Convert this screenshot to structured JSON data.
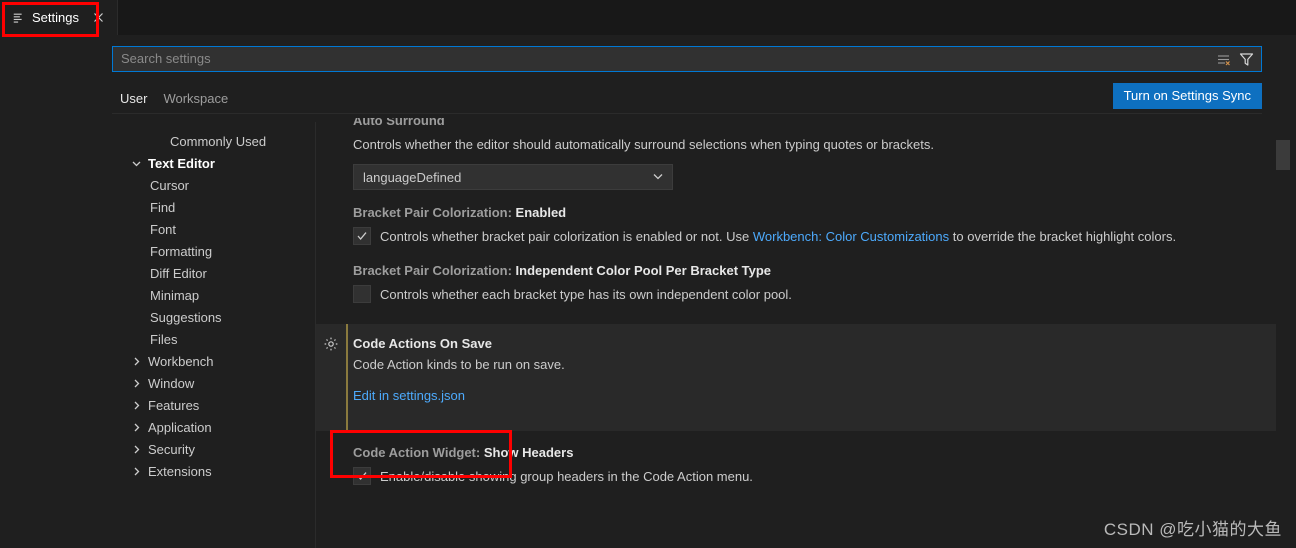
{
  "window": {
    "tab": {
      "label": "Settings",
      "icon": "settings-list-icon",
      "close_icon": "close-icon"
    }
  },
  "search": {
    "placeholder": "Search settings",
    "value": "",
    "clear_filters_icon": "clear-filters-icon",
    "filter_icon": "filter-funnel-icon"
  },
  "scope": {
    "tabs": [
      {
        "label": "User",
        "active": true
      },
      {
        "label": "Workspace",
        "active": false
      }
    ],
    "sync_button": "Turn on Settings Sync"
  },
  "toc": {
    "items": [
      {
        "label": "Commonly Used",
        "level": 0,
        "chevron": "none",
        "selected": false
      },
      {
        "label": "Text Editor",
        "level": 0,
        "chevron": "down",
        "selected": true
      },
      {
        "label": "Cursor",
        "level": 1,
        "chevron": "none",
        "selected": false
      },
      {
        "label": "Find",
        "level": 1,
        "chevron": "none",
        "selected": false
      },
      {
        "label": "Font",
        "level": 1,
        "chevron": "none",
        "selected": false
      },
      {
        "label": "Formatting",
        "level": 1,
        "chevron": "none",
        "selected": false
      },
      {
        "label": "Diff Editor",
        "level": 1,
        "chevron": "none",
        "selected": false
      },
      {
        "label": "Minimap",
        "level": 1,
        "chevron": "none",
        "selected": false
      },
      {
        "label": "Suggestions",
        "level": 1,
        "chevron": "none",
        "selected": false
      },
      {
        "label": "Files",
        "level": 1,
        "chevron": "none",
        "selected": false
      },
      {
        "label": "Workbench",
        "level": 0,
        "chevron": "right",
        "selected": false
      },
      {
        "label": "Window",
        "level": 0,
        "chevron": "right",
        "selected": false
      },
      {
        "label": "Features",
        "level": 0,
        "chevron": "right",
        "selected": false
      },
      {
        "label": "Application",
        "level": 0,
        "chevron": "right",
        "selected": false
      },
      {
        "label": "Security",
        "level": 0,
        "chevron": "right",
        "selected": false
      },
      {
        "label": "Extensions",
        "level": 0,
        "chevron": "right",
        "selected": false
      }
    ]
  },
  "settings": {
    "auto_surround": {
      "title_prefix": "",
      "title_value": "Auto Surround",
      "description": "Controls whether the editor should automatically surround selections when typing quotes or brackets.",
      "select_value": "languageDefined",
      "chevron_icon": "chevron-down-icon"
    },
    "bracket_enabled": {
      "title_prefix": "Bracket Pair Colorization: ",
      "title_value": "Enabled",
      "checked": true,
      "desc_before": "Controls whether bracket pair colorization is enabled or not. Use ",
      "desc_link": "Workbench: Color Customizations",
      "desc_after": " to override the bracket highlight colors."
    },
    "bracket_independent": {
      "title_prefix": "Bracket Pair Colorization: ",
      "title_value": "Independent Color Pool Per Bracket Type",
      "checked": false,
      "description": "Controls whether each bracket type has its own independent color pool."
    },
    "code_actions_on_save": {
      "title_prefix": "",
      "title_value": "Code Actions On Save",
      "description": "Code Action kinds to be run on save.",
      "edit_link": "Edit in settings.json",
      "gear_icon": "gear-icon",
      "modified": true
    },
    "code_action_widget": {
      "title_prefix": "Code Action Widget: ",
      "title_value": "Show Headers",
      "checked": true,
      "description": "Enable/disable showing group headers in the Code Action menu."
    }
  },
  "watermark": "CSDN @吃小猫的大鱼",
  "colors": {
    "accent": "#0078d4",
    "button": "#0e70c0",
    "link": "#4daafc",
    "annotation": "#fe0000",
    "modified_indicator": "#8a7a3e"
  }
}
